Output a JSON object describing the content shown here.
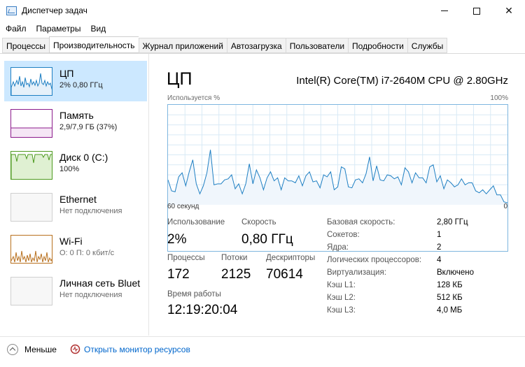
{
  "window": {
    "title": "Диспетчер задач",
    "minimize": "",
    "maximize": "",
    "close": "✕"
  },
  "menu": [
    "Файл",
    "Параметры",
    "Вид"
  ],
  "tabs": [
    {
      "label": "Процессы",
      "active": false
    },
    {
      "label": "Производительность",
      "active": true
    },
    {
      "label": "Журнал приложений",
      "active": false
    },
    {
      "label": "Автозагрузка",
      "active": false
    },
    {
      "label": "Пользователи",
      "active": false
    },
    {
      "label": "Подробности",
      "active": false
    },
    {
      "label": "Службы",
      "active": false
    }
  ],
  "sidebar": {
    "items": [
      {
        "name": "ЦП",
        "sub": "2% 0,80 ГГц",
        "selected": true,
        "color": "#1e7fc3"
      },
      {
        "name": "Память",
        "sub": "2,9/7,9 ГБ (37%)",
        "selected": false,
        "color": "#8b1a8b"
      },
      {
        "name": "Диск 0 (C:)",
        "sub": "100%",
        "selected": false,
        "color": "#4d9a1f"
      },
      {
        "name": "Ethernet",
        "sub": "Нет подключения",
        "selected": false,
        "color": "#a0a0a0"
      },
      {
        "name": "Wi-Fi",
        "sub": "О: 0 П: 0 кбит/с",
        "selected": false,
        "color": "#b8701e"
      },
      {
        "name": "Личная сеть Bluet",
        "sub": "Нет подключения",
        "selected": false,
        "color": "#a0a0a0"
      }
    ]
  },
  "main": {
    "title": "ЦП",
    "cpu_model": "Intel(R) Core(TM) i7-2640M CPU @ 2.80GHz",
    "graph": {
      "top_left": "Используется %",
      "top_right": "100%",
      "bottom_left": "60 секунд",
      "bottom_right": "0",
      "line_color": "#1e7fc3",
      "fill_color": "#f0f6fc",
      "grid_color": "#d9eaf6",
      "usage_percent": [
        25,
        14,
        13,
        28,
        32,
        19,
        33,
        45,
        21,
        11,
        19,
        32,
        55,
        20,
        21,
        21,
        25,
        26,
        30,
        16,
        21,
        11,
        21,
        41,
        21,
        35,
        27,
        15,
        27,
        33,
        24,
        27,
        15,
        27,
        24,
        24,
        22,
        29,
        19,
        29,
        33,
        23,
        24,
        17,
        30,
        28,
        33,
        15,
        18,
        38,
        36,
        18,
        17,
        25,
        26,
        22,
        31,
        48,
        24,
        39,
        25,
        24,
        30,
        29,
        26,
        28,
        20,
        37,
        33,
        22,
        32,
        27,
        27,
        22,
        38,
        40,
        23,
        29,
        16,
        25,
        22,
        18,
        20,
        26,
        20,
        22,
        22,
        14,
        12,
        15,
        11,
        15,
        19,
        10,
        10,
        3,
        2
      ]
    },
    "stats": {
      "usage_label": "Использование",
      "usage_value": "2%",
      "speed_label": "Скорость",
      "speed_value": "0,80 ГГц",
      "processes_label": "Процессы",
      "processes_value": "172",
      "threads_label": "Потоки",
      "threads_value": "2125",
      "handles_label": "Дескрипторы",
      "handles_value": "70614",
      "uptime_label": "Время работы",
      "uptime_value": "12:19:20:04"
    },
    "specs": [
      {
        "key": "Базовая скорость:",
        "value": "2,80 ГГц"
      },
      {
        "key": "Сокетов:",
        "value": "1"
      },
      {
        "key": "Ядра:",
        "value": "2"
      },
      {
        "key": "Логических процессоров:",
        "value": "4"
      },
      {
        "key": "Виртуализация:",
        "value": "Включено"
      },
      {
        "key": "Кэш L1:",
        "value": "128 КБ"
      },
      {
        "key": "Кэш L2:",
        "value": "512 КБ"
      },
      {
        "key": "Кэш L3:",
        "value": "4,0 МБ"
      }
    ]
  },
  "footer": {
    "less_label": "Меньше",
    "monitor_link": "Открыть монитор ресурсов"
  }
}
